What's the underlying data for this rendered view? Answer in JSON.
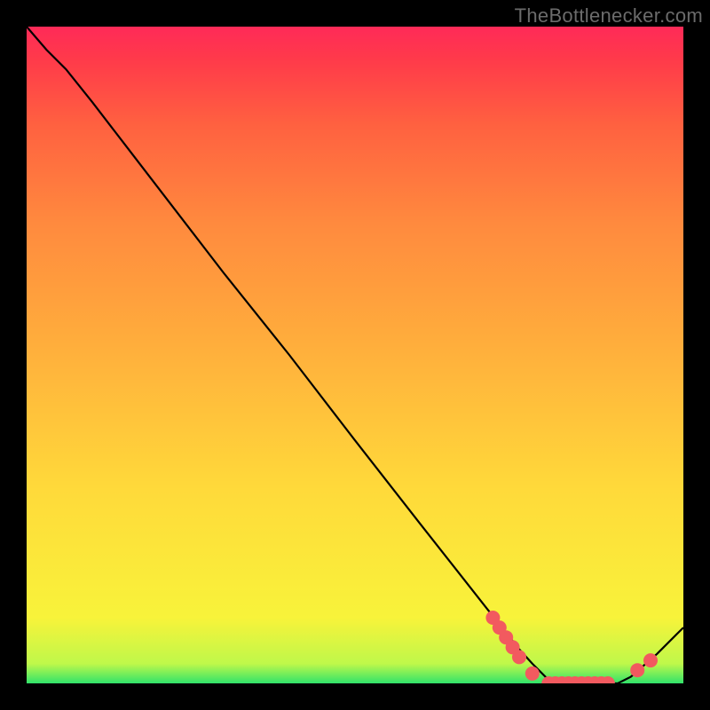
{
  "source_label": "TheBottlenecker.com",
  "chart_data": {
    "type": "line",
    "title": "",
    "xlabel": "",
    "ylabel": "",
    "xlim": [
      0,
      1
    ],
    "ylim": [
      0,
      1
    ],
    "grid": false,
    "gradient_colors": [
      "#31e36a",
      "#bff84a",
      "#f8f33a",
      "#ffd93a",
      "#ffb13c",
      "#ff8a3e",
      "#ff6140",
      "#ff3a4a",
      "#ff2a58"
    ],
    "series": [
      {
        "name": "curve",
        "color": "#000000",
        "x": [
          0.0,
          0.03,
          0.06,
          0.1,
          0.15,
          0.2,
          0.3,
          0.4,
          0.5,
          0.6,
          0.7,
          0.75,
          0.77,
          0.8,
          0.83,
          0.86,
          0.88,
          0.9,
          0.92,
          0.96,
          1.0
        ],
        "y": [
          1.0,
          0.965,
          0.935,
          0.885,
          0.82,
          0.755,
          0.625,
          0.5,
          0.37,
          0.242,
          0.115,
          0.052,
          0.03,
          0.0,
          0.0,
          0.0,
          0.0,
          0.0,
          0.01,
          0.045,
          0.085
        ]
      }
    ],
    "markers": [
      {
        "x": 0.71,
        "y": 0.1
      },
      {
        "x": 0.72,
        "y": 0.085
      },
      {
        "x": 0.73,
        "y": 0.07
      },
      {
        "x": 0.74,
        "y": 0.055
      },
      {
        "x": 0.75,
        "y": 0.04
      },
      {
        "x": 0.77,
        "y": 0.015
      },
      {
        "x": 0.795,
        "y": 0.0
      },
      {
        "x": 0.805,
        "y": 0.0
      },
      {
        "x": 0.815,
        "y": 0.0
      },
      {
        "x": 0.825,
        "y": 0.0
      },
      {
        "x": 0.835,
        "y": 0.0
      },
      {
        "x": 0.845,
        "y": 0.0
      },
      {
        "x": 0.855,
        "y": 0.0
      },
      {
        "x": 0.865,
        "y": 0.0
      },
      {
        "x": 0.875,
        "y": 0.0
      },
      {
        "x": 0.885,
        "y": 0.0
      },
      {
        "x": 0.93,
        "y": 0.02
      },
      {
        "x": 0.95,
        "y": 0.035
      }
    ],
    "marker_color": "#f25a5f",
    "marker_radius": 8
  }
}
